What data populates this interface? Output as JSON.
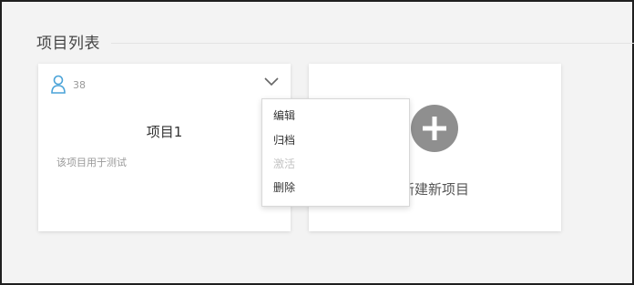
{
  "section": {
    "title": "项目列表"
  },
  "project_card": {
    "member_icon": "user-icon",
    "member_count": "38",
    "menu_toggle_icon": "chevron-down-icon",
    "name": "项目1",
    "description": "该项目用于测试"
  },
  "new_project_card": {
    "icon": "plus-icon",
    "label": "新建新项目"
  },
  "menu": {
    "items": [
      {
        "label": "编辑",
        "disabled": false
      },
      {
        "label": "归档",
        "disabled": false
      },
      {
        "label": "激活",
        "disabled": true
      },
      {
        "label": "删除",
        "disabled": false
      }
    ]
  },
  "colors": {
    "accent_icon": "#4aa3d8",
    "page_bg": "#f3f3f3",
    "card_bg": "#ffffff",
    "add_circle": "#8f8f8f"
  }
}
